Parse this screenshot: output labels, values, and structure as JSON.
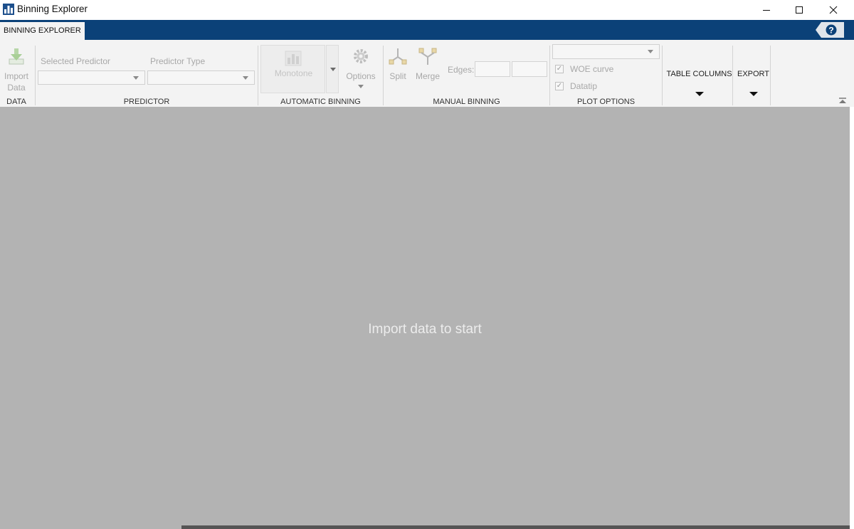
{
  "window": {
    "title": "Binning Explorer",
    "icon": "bar-chart-icon",
    "controls": [
      "minimize-icon",
      "maximize-icon",
      "close-icon"
    ]
  },
  "tabs": [
    {
      "label": "BINNING EXPLORER",
      "active": true
    }
  ],
  "colors": {
    "tab_strip": "#0b4178",
    "ribbon_bg": "#f3f3f3",
    "main_bg": "#b3b3b3",
    "disabled_text": "#a8a8a8"
  },
  "ribbon": {
    "data": {
      "group_label": "DATA",
      "import_line1": "Import",
      "import_line2": "Data"
    },
    "predictor": {
      "group_label": "PREDICTOR",
      "selected_label": "Selected Predictor",
      "selected_value": "",
      "type_label": "Predictor Type",
      "type_value": ""
    },
    "automatic_binning": {
      "group_label": "AUTOMATIC BINNING",
      "algorithm": "Monotone",
      "options_label": "Options"
    },
    "manual_binning": {
      "group_label": "MANUAL BINNING",
      "split_label": "Split",
      "merge_label": "Merge",
      "edges_label": "Edges:",
      "edge1_value": "",
      "edge2_value": ""
    },
    "plot_options": {
      "group_label": "PLOT OPTIONS",
      "plot_select_value": "",
      "woe_label": "WOE curve",
      "woe_checked": true,
      "datatip_label": "Datatip",
      "datatip_checked": true
    },
    "table_columns": {
      "label": "TABLE COLUMNS"
    },
    "export": {
      "label": "EXPORT"
    }
  },
  "main": {
    "placeholder": "Import data to start"
  }
}
